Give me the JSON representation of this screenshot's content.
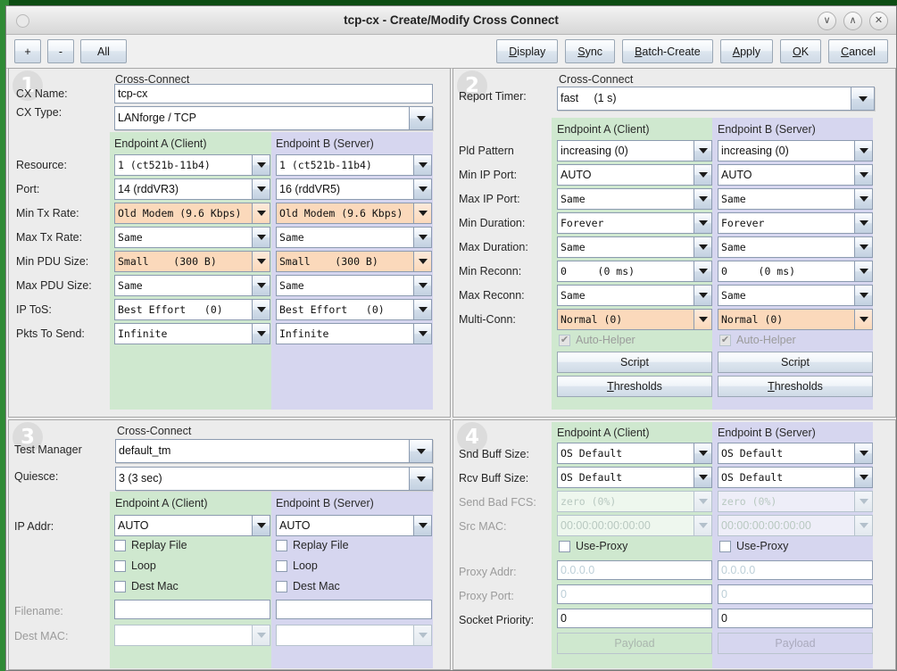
{
  "window": {
    "title": "tcp-cx - Create/Modify Cross Connect",
    "buttons": {
      "minimize": "∨",
      "maximize": "∧",
      "close": "✕"
    }
  },
  "toolbar": {
    "plus": "+",
    "minus": "-",
    "all": "All",
    "display": "Display",
    "sync": "Sync",
    "batch_create": "Batch-Create",
    "apply": "Apply",
    "ok": "OK",
    "cancel": "Cancel",
    "mnemonics": {
      "display": "D",
      "sync": "S",
      "batch_create": "B",
      "apply": "A",
      "ok": "O",
      "cancel": "C"
    }
  },
  "endpoint_headers": {
    "a": "Endpoint A  (Client)",
    "b": "Endpoint B  (Server)"
  },
  "panel1": {
    "badge": "1",
    "group_title": "Cross-Connect",
    "labels": {
      "cx_name": "CX Name:",
      "cx_type": "CX Type:",
      "resource": "Resource:",
      "port": "Port:",
      "min_tx_rate": "Min Tx Rate:",
      "max_tx_rate": "Max Tx Rate:",
      "min_pdu_size": "Min PDU Size:",
      "max_pdu_size": "Max PDU Size:",
      "ip_tos": "IP ToS:",
      "pkts_to_send": "Pkts To Send:"
    },
    "cx_name": "tcp-cx",
    "cx_type": "LANforge / TCP",
    "rows": [
      {
        "key": "resource",
        "a": "1 (ct521b-11b4)",
        "b": "1 (ct521b-11b4)",
        "modified": false
      },
      {
        "key": "port",
        "a": "14 (rddVR3)",
        "b": "16 (rddVR5)",
        "modified": false
      },
      {
        "key": "min_tx_rate",
        "a": "Old Modem (9.6 Kbps)",
        "b": "Old Modem (9.6 Kbps)",
        "modified": true
      },
      {
        "key": "max_tx_rate",
        "a": "Same",
        "b": "Same",
        "modified": false
      },
      {
        "key": "min_pdu_size",
        "a": "Small    (300 B)",
        "b": "Small    (300 B)",
        "modified": true
      },
      {
        "key": "max_pdu_size",
        "a": "Same",
        "b": "Same",
        "modified": false
      },
      {
        "key": "ip_tos",
        "a": "Best Effort   (0)",
        "b": "Best Effort   (0)",
        "modified": false
      },
      {
        "key": "pkts_to_send",
        "a": "Infinite",
        "b": "Infinite",
        "modified": false
      }
    ]
  },
  "panel2": {
    "badge": "2",
    "group_title": "Cross-Connect",
    "labels": {
      "report_timer": "Report Timer:",
      "pld_pattern": "Pld Pattern",
      "min_ip_port": "Min IP Port:",
      "max_ip_port": "Max IP Port:",
      "min_duration": "Min Duration:",
      "max_duration": "Max Duration:",
      "min_reconn": "Min Reconn:",
      "max_reconn": "Max Reconn:",
      "multi_conn": "Multi-Conn:"
    },
    "report_timer": "fast     (1 s)",
    "rows": [
      {
        "key": "pld_pattern",
        "a": "increasing (0)",
        "b": "increasing (0)",
        "modified": false,
        "sans": true
      },
      {
        "key": "min_ip_port",
        "a": "AUTO",
        "b": "AUTO",
        "modified": false,
        "sans": true
      },
      {
        "key": "max_ip_port",
        "a": "Same",
        "b": "Same",
        "modified": false,
        "sans": true
      },
      {
        "key": "min_duration",
        "a": "Forever",
        "b": "Forever",
        "modified": false
      },
      {
        "key": "max_duration",
        "a": "Same",
        "b": "Same",
        "modified": false
      },
      {
        "key": "min_reconn",
        "a": "0     (0 ms)",
        "b": "0     (0 ms)",
        "modified": false
      },
      {
        "key": "max_reconn",
        "a": "Same",
        "b": "Same",
        "modified": false
      },
      {
        "key": "multi_conn",
        "a": "Normal (0)",
        "b": "Normal (0)",
        "modified": true
      }
    ],
    "auto_helper": {
      "label": "Auto-Helper",
      "checked": true,
      "mark": "✔"
    },
    "script_button": "Script",
    "thresholds_button": "Thresholds",
    "thresholds_mnemonic": "T"
  },
  "panel3": {
    "badge": "3",
    "group_title": "Cross-Connect",
    "labels": {
      "test_manager": "Test Manager",
      "quiesce": "Quiesce:",
      "ip_addr": "IP Addr:",
      "filename": "Filename:",
      "dest_mac": "Dest MAC:"
    },
    "test_manager": "default_tm",
    "quiesce": "3 (3 sec)",
    "ip_addr": {
      "a": "AUTO",
      "b": "AUTO"
    },
    "checkboxes": [
      {
        "label": "Replay File",
        "a_checked": false,
        "b_checked": false
      },
      {
        "label": "Loop",
        "a_checked": false,
        "b_checked": false
      },
      {
        "label": "Dest Mac",
        "a_checked": false,
        "b_checked": false
      }
    ],
    "filename": {
      "a": "",
      "b": ""
    },
    "dest_mac_value": {
      "a": "",
      "b": ""
    }
  },
  "panel4": {
    "badge": "4",
    "labels": {
      "snd_buff_size": "Snd Buff Size:",
      "rcv_buff_size": "Rcv Buff Size:",
      "send_bad_fcs": "Send Bad FCS:",
      "src_mac": "Src MAC:",
      "proxy_addr": "Proxy Addr:",
      "proxy_port": "Proxy Port:",
      "socket_priority": "Socket Priority:"
    },
    "rows": [
      {
        "key": "snd_buff_size",
        "a": "OS Default",
        "b": "OS Default",
        "disabled": false
      },
      {
        "key": "rcv_buff_size",
        "a": "OS Default",
        "b": "OS Default",
        "disabled": false
      },
      {
        "key": "send_bad_fcs",
        "a": "zero (0%)",
        "b": "zero (0%)",
        "disabled": true
      },
      {
        "key": "src_mac",
        "a": "00:00:00:00:00:00",
        "b": "00:00:00:00:00:00",
        "disabled": true
      }
    ],
    "use_proxy": {
      "label": "Use-Proxy",
      "a_checked": false,
      "b_checked": false
    },
    "proxy_addr": {
      "a": "0.0.0.0",
      "b": "0.0.0.0"
    },
    "proxy_port": {
      "a": "0",
      "b": "0"
    },
    "socket_priority": {
      "a": "0",
      "b": "0"
    },
    "payload_button": "Payload"
  },
  "colors": {
    "endpoint_a_panel": "#cfe8cf",
    "endpoint_b_panel": "#d6d6ef",
    "modified_field": "#fbd9bb",
    "window_bg": "#ececec",
    "desktop": "#0d4d13"
  }
}
